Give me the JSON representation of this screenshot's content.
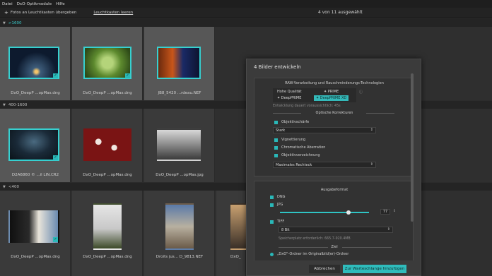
{
  "menu": {
    "items": [
      "Datei",
      "DxO-Optikmodule",
      "Hilfe"
    ]
  },
  "toolbar": {
    "add_label": "Fotos an Leuchtkasten übergeben",
    "clear_label": "Leuchtkasten leeren",
    "selection_count": "4 von 11 ausgewählt"
  },
  "groups": [
    {
      "name": ">1600",
      "active": true
    },
    {
      "name": "400-1600",
      "active": false
    },
    {
      "name": "<400",
      "active": false
    }
  ],
  "thumbs": {
    "row1": [
      {
        "caption": "DxO_DeepP ...opMas.dng"
      },
      {
        "caption": "DxO_DeepP ...opMas.dng"
      },
      {
        "caption": "JB8_5420 ...rdeau.NEF"
      }
    ],
    "row2": [
      {
        "caption": "D2A6860 © ...il LIN.CR2"
      },
      {
        "caption": "DxO_DeepP ...opMas.dng"
      },
      {
        "caption": "DxO_DeepP ...opMas.jpg"
      }
    ],
    "row3": [
      {
        "caption": "DxO_DeepP ...opMas.dng"
      },
      {
        "caption": "DxO_DeepP ...opMas.dng"
      },
      {
        "caption": "Droits jus... D_9813.NEF"
      },
      {
        "caption": "DxO_"
      }
    ]
  },
  "dialog": {
    "title": "4 Bilder entwickeln",
    "raw_section": "RAW-Verarbeitung und Rauschminderungs-Technologien",
    "opt_hq": "Hohe Qualität",
    "opt_prime": "PRIME",
    "opt_deepprime": "DeepPRIME",
    "opt_deepprime_xd": "DeepPRIME XD",
    "time_hint": "Entwicklung dauert voraussichtlich: 45s",
    "optical_section": "Optische Korrekturen",
    "cb_sharpness": "Objektivschärfe",
    "sharpness_value": "Stark",
    "cb_vignetting": "Vignettierung",
    "cb_chromatic": "Chromatische Aberration",
    "cb_distortion": "Objektivverzeichnung",
    "distortion_value": "Maximales Rechteck",
    "output_section": "Ausgabeformat",
    "fmt_dng": "DNG",
    "fmt_jpg": "JPG",
    "jpg_quality": "77",
    "jpg_quality_fraction": 0.77,
    "fmt_tiff": "TIFF",
    "tiff_bits": "8 Bit",
    "space_hint": "Speicherplatz erforderlich: 665.7-920.4MB",
    "target_section": "Ziel",
    "target_option": "„DxO\"-Ordner im Originalbild(er)-Ordner",
    "cancel_label": "Abbrechen",
    "queue_label": "Zur Warteschlange hinzufügen"
  },
  "colors": {
    "accent": "#36d0d0",
    "dialog_bg": "#3b3b3b",
    "app_bg": "#2b2b2b"
  },
  "icons": [
    "plus-icon",
    "chevron-down-icon",
    "check-icon",
    "info-icon",
    "chevron-updown-icon"
  ]
}
